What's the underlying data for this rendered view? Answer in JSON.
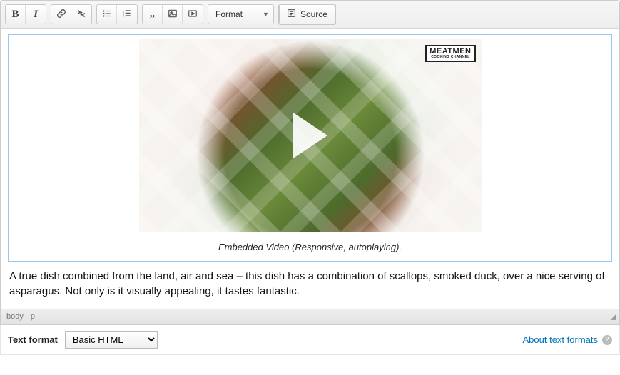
{
  "toolbar": {
    "format_label": "Format",
    "source_label": "Source"
  },
  "embed": {
    "badge_line1": "MEATMEN",
    "badge_line2": "COOKING CHANNEL",
    "caption": "Embedded Video (Responsive, autoplaying)."
  },
  "body_paragraph": "A true dish combined from the land, air and sea – this dish has a combination of scallops, smoked duck, over a nice serving of asparagus. Not only is it visually appealing, it tastes fantastic.",
  "path": {
    "seg1": "body",
    "seg2": "p"
  },
  "format_row": {
    "label": "Text format",
    "selected": "Basic HTML",
    "about": "About text formats"
  }
}
